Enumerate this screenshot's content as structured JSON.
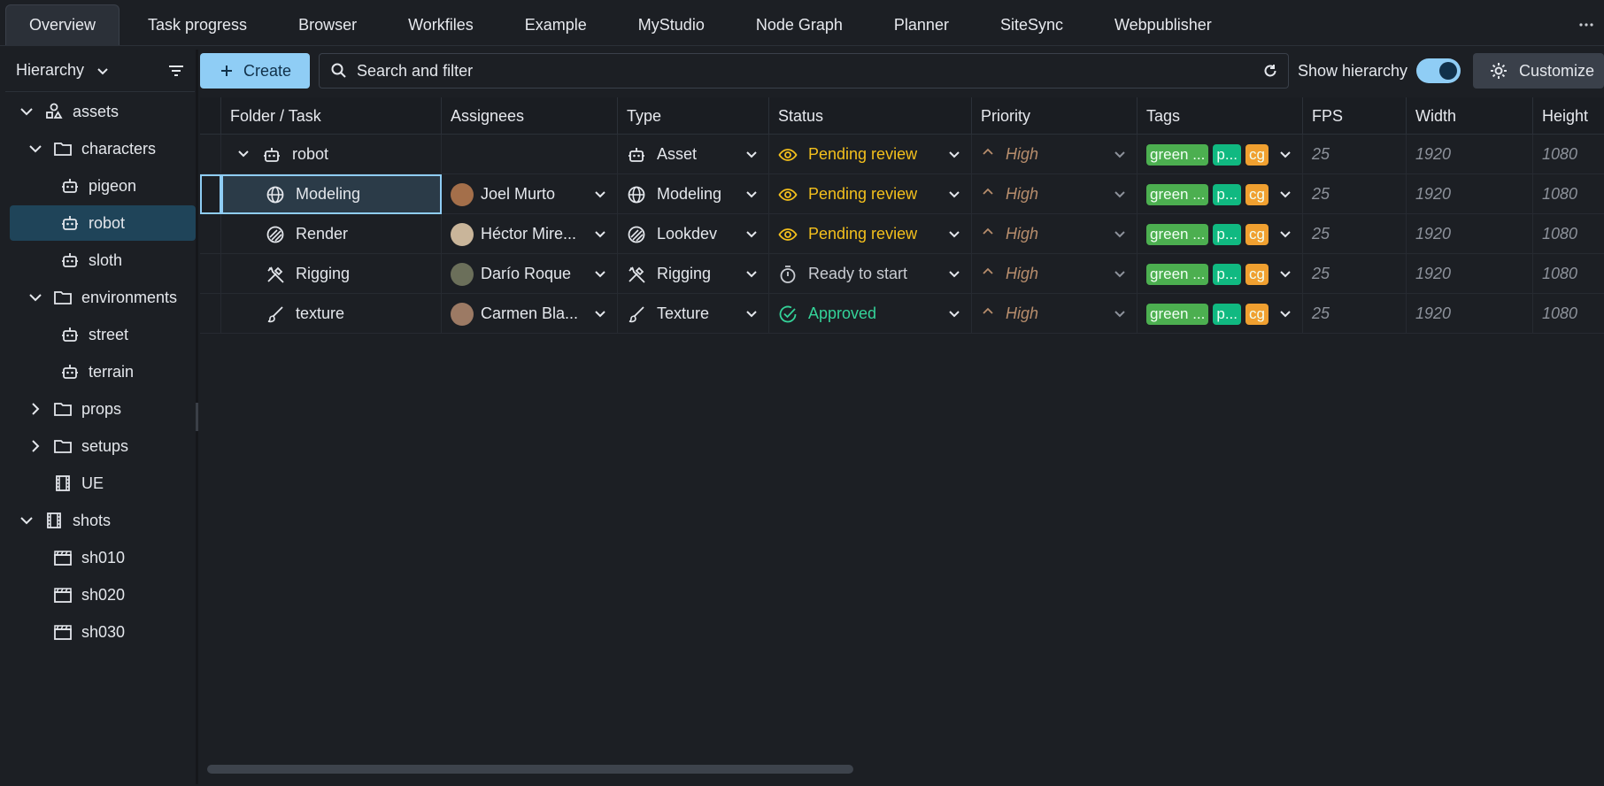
{
  "tabs": [
    {
      "label": "Overview",
      "active": true
    },
    {
      "label": "Task progress"
    },
    {
      "label": "Browser"
    },
    {
      "label": "Workfiles"
    },
    {
      "label": "Example"
    },
    {
      "label": "MyStudio"
    },
    {
      "label": "Node Graph"
    },
    {
      "label": "Planner"
    },
    {
      "label": "SiteSync"
    },
    {
      "label": "Webpublisher"
    }
  ],
  "left_panel": {
    "selector_label": "Hierarchy",
    "tree": [
      {
        "label": "assets",
        "icon": "assets-icon"
      },
      {
        "label": "characters",
        "icon": "folder-icon"
      },
      {
        "label": "pigeon",
        "icon": "robot-icon"
      },
      {
        "label": "robot",
        "icon": "robot-icon",
        "selected": true
      },
      {
        "label": "sloth",
        "icon": "robot-icon"
      },
      {
        "label": "environments",
        "icon": "folder-icon"
      },
      {
        "label": "street",
        "icon": "robot-icon"
      },
      {
        "label": "terrain",
        "icon": "robot-icon"
      },
      {
        "label": "props",
        "icon": "folder-icon"
      },
      {
        "label": "setups",
        "icon": "folder-icon"
      },
      {
        "label": "UE",
        "icon": "film-icon"
      },
      {
        "label": "shots",
        "icon": "film-icon"
      },
      {
        "label": "sh010",
        "icon": "clapper-icon"
      },
      {
        "label": "sh020",
        "icon": "clapper-icon"
      },
      {
        "label": "sh030",
        "icon": "clapper-icon"
      }
    ]
  },
  "toolbar": {
    "create_label": "Create",
    "search_placeholder": "Search and filter",
    "show_hierarchy_label": "Show hierarchy",
    "show_hierarchy_on": true,
    "customize_label": "Customize"
  },
  "columns": [
    "Folder / Task",
    "Assignees",
    "Type",
    "Status",
    "Priority",
    "Tags",
    "FPS",
    "Width",
    "Height"
  ],
  "rows": [
    {
      "name": "robot",
      "icon": "robot-icon",
      "assignee": "",
      "type": "Asset",
      "type_icon": "robot-icon",
      "status": "Pending review",
      "status_kind": "pending",
      "priority": "High",
      "tags": [
        "green ...",
        "p...",
        "cg"
      ],
      "fps": "25",
      "width": "1920",
      "height": "1080"
    },
    {
      "name": "Modeling",
      "icon": "globe-icon",
      "assignee": "Joel Murto",
      "type": "Modeling",
      "type_icon": "globe-icon",
      "status": "Pending review",
      "status_kind": "pending",
      "priority": "High",
      "tags": [
        "green ...",
        "p...",
        "cg"
      ],
      "fps": "25",
      "width": "1920",
      "height": "1080",
      "selected": true
    },
    {
      "name": "Render",
      "icon": "render-icon",
      "assignee": "Héctor Mire...",
      "type": "Lookdev",
      "type_icon": "render-icon",
      "status": "Pending review",
      "status_kind": "pending",
      "priority": "High",
      "tags": [
        "green ...",
        "p...",
        "cg"
      ],
      "fps": "25",
      "width": "1920",
      "height": "1080"
    },
    {
      "name": "Rigging",
      "icon": "tools-icon",
      "assignee": "Darío Roque",
      "type": "Rigging",
      "type_icon": "tools-icon",
      "status": "Ready to start",
      "status_kind": "ready",
      "priority": "High",
      "tags": [
        "green ...",
        "p...",
        "cg"
      ],
      "fps": "25",
      "width": "1920",
      "height": "1080"
    },
    {
      "name": "texture",
      "icon": "brush-icon",
      "assignee": "Carmen Bla...",
      "type": "Texture",
      "type_icon": "brush-icon",
      "status": "Approved",
      "status_kind": "approved",
      "priority": "High",
      "tags": [
        "green ...",
        "p...",
        "cg"
      ],
      "fps": "25",
      "width": "1920",
      "height": "1080"
    }
  ],
  "colors": {
    "accent": "#8fcdf5",
    "pending": "#f4c01c",
    "approved": "#34d399",
    "priority": "#b78d6c"
  }
}
